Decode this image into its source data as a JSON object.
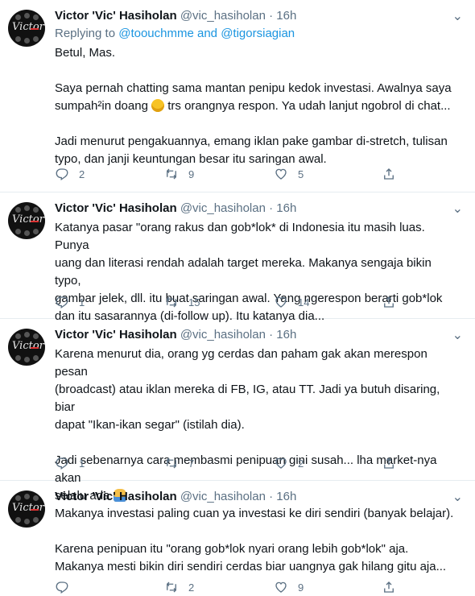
{
  "colors": {
    "accent": "#1b95e0",
    "muted": "#5b7083"
  },
  "tweets": [
    {
      "name": "Victor 'Vic' Hasiholan",
      "handle": "@vic_hasiholan",
      "sep": "·",
      "time": "16h",
      "reply_prefix": "Replying to ",
      "reply_user1": "@toouchmme",
      "reply_and": " and ",
      "reply_user2": "@tigorsiagian",
      "p1": "Betul, Mas.",
      "p2a": "Saya pernah chatting sama mantan penipu kedok investasi. Awalnya saya\nsumpah²in doang ",
      "p2b": " trs orangnya respon. Ya udah lanjut ngobrol di chat...",
      "p3": "Jadi menurut pengakuannya, emang iklan pake gambar di-stretch, tulisan\ntypo, dan janji keuntungan besar itu saringan awal.",
      "replies": "2",
      "retweets": "9",
      "likes": "5"
    },
    {
      "name": "Victor 'Vic' Hasiholan",
      "handle": "@vic_hasiholan",
      "sep": "·",
      "time": "16h",
      "p1": "Katanya pasar \"orang rakus dan gob*lok* di Indonesia itu masih luas. Punya\nuang dan literasi rendah adalah target mereka. Makanya sengaja bikin typo,\ngambar jelek, dll. itu buat saringan awal. Yang ngerespon berarti gob*lok\ndan itu sasarannya (di-follow up). Itu katanya dia...",
      "replies": "1",
      "retweets": "15",
      "likes": "14"
    },
    {
      "name": "Victor 'Vic' Hasiholan",
      "handle": "@vic_hasiholan",
      "sep": "·",
      "time": "16h",
      "p1": "Karena menurut dia, orang yg cerdas dan paham gak akan merespon pesan\n(broadcast) atau iklan mereka di FB, IG, atau TT. Jadi ya butuh disaring, biar\ndapat \"Ikan-ikan segar\" (istilah dia).",
      "p2a": "Jadi sebenarnya cara membasmi penipuan gini susah... lha market-nya akan\nselalu ada ",
      "replies": "1",
      "retweets": "7",
      "likes": "2"
    },
    {
      "name": "Victor 'Vic' Hasiholan",
      "handle": "@vic_hasiholan",
      "sep": "·",
      "time": "16h",
      "p1": "Makanya investasi paling cuan ya investasi ke diri sendiri (banyak belajar).",
      "p2a": "Karena penipuan itu \"orang gob*lok nyari orang lebih gob*lok\" aja.\nMakanya mesti bikin diri sendiri cerdas biar uangnya gak hilang gitu aja...",
      "replies": "",
      "retweets": "2",
      "likes": "9"
    }
  ],
  "avatar_text": "Victor"
}
